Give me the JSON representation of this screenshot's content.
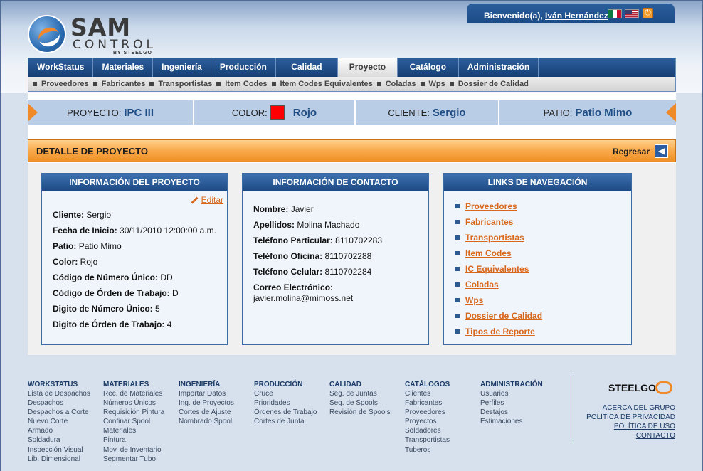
{
  "header": {
    "logo": {
      "name": "SAM",
      "sub": "CONTROL",
      "by": "BY STEELGO"
    },
    "welcome_prefix": "Bienvenido(a),",
    "user_name": "Iván Hernández",
    "flags": [
      "mexico-flag-icon",
      "usa-flag-icon"
    ],
    "power_icon": "power-icon"
  },
  "nav": {
    "tabs": [
      {
        "label": "WorkStatus"
      },
      {
        "label": "Materiales"
      },
      {
        "label": "Ingeniería"
      },
      {
        "label": "Producción"
      },
      {
        "label": "Calidad"
      },
      {
        "label": "Proyecto",
        "active": true
      },
      {
        "label": "Catálogo"
      },
      {
        "label": "Administración"
      }
    ],
    "subitems": [
      "Proveedores",
      "Fabricantes",
      "Transportistas",
      "Item Codes",
      "Item Codes Equivalentes",
      "Coladas",
      "Wps",
      "Dossier de Calidad"
    ]
  },
  "infobar": {
    "proyecto_label": "PROYECTO:",
    "proyecto_value": "IPC III",
    "color_label": "COLOR:",
    "color_value": "Rojo",
    "color_hex": "#ff0000",
    "cliente_label": "CLIENTE:",
    "cliente_value": "Sergio",
    "patio_label": "PATIO:",
    "patio_value": "Patio Mimo"
  },
  "detail": {
    "title": "DETALLE DE PROYECTO",
    "back_label": "Regresar"
  },
  "project_info": {
    "title": "INFORMACIÓN DEL PROYECTO",
    "edit_label": "Editar",
    "rows": [
      {
        "label": "Cliente:",
        "value": "Sergio"
      },
      {
        "label": "Fecha de Inicio:",
        "value": "30/11/2010 12:00:00 a.m."
      },
      {
        "label": "Patio:",
        "value": "Patio Mimo"
      },
      {
        "label": "Color:",
        "value": "Rojo"
      },
      {
        "label": "Código de Número Único:",
        "value": "DD"
      },
      {
        "label": "Código de Órden de Trabajo:",
        "value": "D"
      },
      {
        "label": "Digito de Número Único:",
        "value": "5"
      },
      {
        "label": "Digito de Órden de Trabajo:",
        "value": "4"
      }
    ]
  },
  "contact_info": {
    "title": "INFORMACIÓN DE CONTACTO",
    "rows": [
      {
        "label": "Nombre:",
        "value": "Javier"
      },
      {
        "label": "Apellidos:",
        "value": "Molina Machado"
      },
      {
        "label": "Teléfono Particular:",
        "value": "8110702283"
      },
      {
        "label": "Teléfono Oficina:",
        "value": "8110702288"
      },
      {
        "label": "Teléfono Celular:",
        "value": "8110702284"
      }
    ],
    "email_label": "Correo Electrónico:",
    "email_value": "javier.molina@mimoss.net"
  },
  "nav_links": {
    "title": "LINKS DE NAVEGACIÓN",
    "items": [
      "Proveedores",
      "Fabricantes",
      "Transportistas",
      "Item Codes",
      "IC Equivalentes",
      "Coladas",
      "Wps",
      "Dossier de Calidad",
      "Tipos de Reporte"
    ]
  },
  "footer": {
    "columns": [
      {
        "title": "WORKSTATUS",
        "items": [
          "Lista de Despachos",
          "Despachos",
          "Despachos a Corte",
          "Nuevo Corte",
          "Armado",
          "Soldadura",
          "Inspección Visual",
          "Lib. Dimensional"
        ]
      },
      {
        "title": "MATERIALES",
        "items": [
          "Rec. de Materiales",
          "Números Únicos",
          "Requisición Pintura",
          "Confinar Spool",
          "Materiales",
          "Pintura",
          "Mov. de Inventario",
          "Segmentar Tubo"
        ]
      },
      {
        "title": "INGENIERÍA",
        "items": [
          "Importar Datos",
          "Ing. de Proyectos",
          "Cortes de Ajuste",
          "Nombrado Spool"
        ]
      },
      {
        "title": "PRODUCCIÓN",
        "items": [
          "Cruce",
          "Prioridades",
          "Órdenes de Trabajo",
          "Cortes de Junta"
        ]
      },
      {
        "title": "CALIDAD",
        "items": [
          "Seg. de Juntas",
          "Seg. de Spools",
          "Revisión de Spools"
        ]
      },
      {
        "title": "CATÁLOGOS",
        "items": [
          "Clientes",
          "Fabricantes",
          "Proveedores",
          "Proyectos",
          "Soldadores",
          "Transportistas",
          "Tuberos"
        ]
      },
      {
        "title": "ADMINISTRACIÓN",
        "items": [
          "Usuarios",
          "Perfiles",
          "Destajos",
          "Estimaciones"
        ]
      }
    ],
    "brand": "STEELGO",
    "links": [
      "ACERCA DEL GRUPO",
      "POLÍTICA DE PRIVACIDAD",
      "POLÍTICA DE USO",
      "CONTACTO"
    ]
  }
}
